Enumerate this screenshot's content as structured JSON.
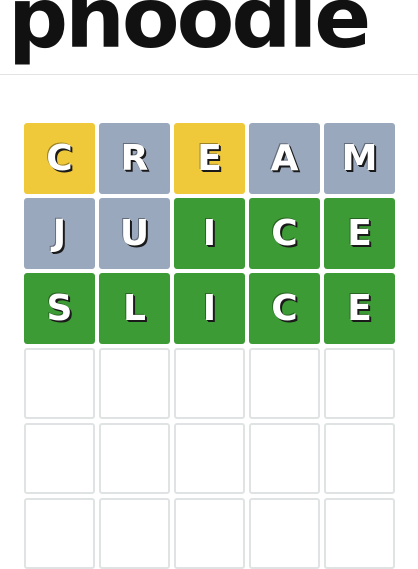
{
  "header": {
    "logo_text": "phoodle"
  },
  "board": {
    "colors": {
      "correct": "#3d9b35",
      "present": "#f0c93a",
      "absent": "#9aa8bd",
      "empty_border": "#dfe3e3"
    },
    "rows": [
      {
        "letters": [
          "C",
          "R",
          "E",
          "A",
          "M"
        ],
        "states": [
          "present",
          "absent",
          "present",
          "absent",
          "absent"
        ]
      },
      {
        "letters": [
          "J",
          "U",
          "I",
          "C",
          "E"
        ],
        "states": [
          "absent",
          "absent",
          "correct",
          "correct",
          "correct"
        ]
      },
      {
        "letters": [
          "S",
          "L",
          "I",
          "C",
          "E"
        ],
        "states": [
          "correct",
          "correct",
          "correct",
          "correct",
          "correct"
        ]
      },
      {
        "letters": [
          "",
          "",
          "",
          "",
          ""
        ],
        "states": [
          "empty",
          "empty",
          "empty",
          "empty",
          "empty"
        ]
      },
      {
        "letters": [
          "",
          "",
          "",
          "",
          ""
        ],
        "states": [
          "empty",
          "empty",
          "empty",
          "empty",
          "empty"
        ]
      },
      {
        "letters": [
          "",
          "",
          "",
          "",
          ""
        ],
        "states": [
          "empty",
          "empty",
          "empty",
          "empty",
          "empty"
        ]
      }
    ]
  }
}
